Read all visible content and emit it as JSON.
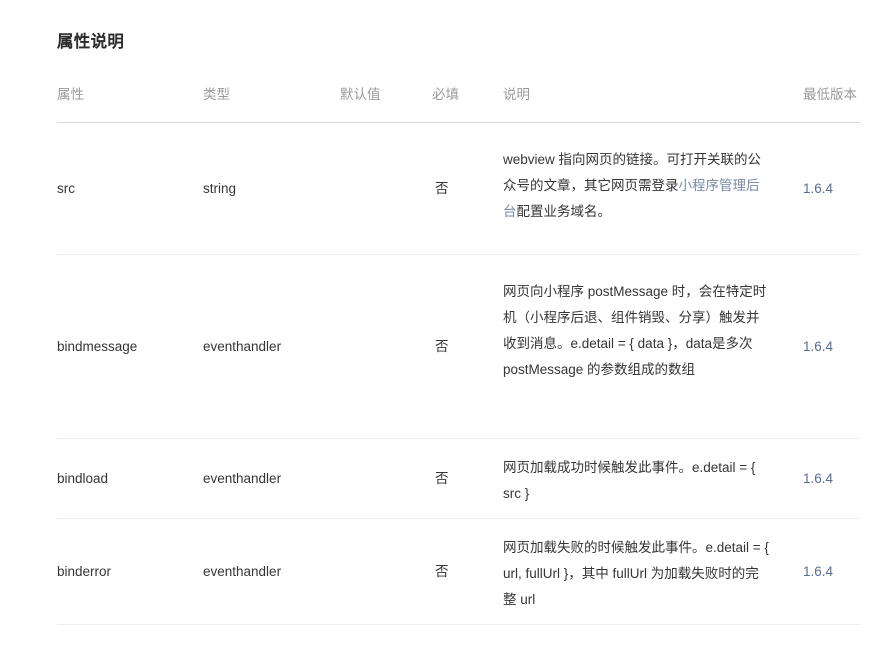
{
  "section": {
    "title": "属性说明"
  },
  "table": {
    "headers": {
      "attribute": "属性",
      "type": "类型",
      "default": "默认值",
      "required": "必填",
      "description": "说明",
      "min_version": "最低版本"
    },
    "rows": [
      {
        "attribute": "src",
        "type": "string",
        "default": "",
        "required": "否",
        "description_before_link": "webview 指向网页的链接。可打开关联的公众号的文章，其它网页需登录",
        "description_link": "小程序管理后台",
        "description_after_link": "配置业务域名。",
        "min_version": "1.6.4"
      },
      {
        "attribute": "bindmessage",
        "type": "eventhandler",
        "default": "",
        "required": "否",
        "description_before_link": "网页向小程序 postMessage 时，会在特定时机（小程序后退、组件销毁、分享）触发并收到消息。e.detail = { data }，data是多次 postMessage 的参数组成的数组",
        "description_link": "",
        "description_after_link": "",
        "min_version": "1.6.4"
      },
      {
        "attribute": "bindload",
        "type": "eventhandler",
        "default": "",
        "required": "否",
        "description_before_link": "网页加载成功时候触发此事件。e.detail = { src }",
        "description_link": "",
        "description_after_link": "",
        "min_version": "1.6.4"
      },
      {
        "attribute": "binderror",
        "type": "eventhandler",
        "default": "",
        "required": "否",
        "description_before_link": "网页加载失败的时候触发此事件。e.detail = { url, fullUrl }，其中 fullUrl 为加载失败时的完整 url",
        "description_link": "",
        "description_after_link": "",
        "min_version": "1.6.4"
      }
    ]
  },
  "colors": {
    "link": "#576b95",
    "inline_link": "#7a8aa8",
    "header_text": "#9a9a9a",
    "body_text": "#353535",
    "divider": "#d6d6d8",
    "divider_light": "#eeeef0"
  }
}
